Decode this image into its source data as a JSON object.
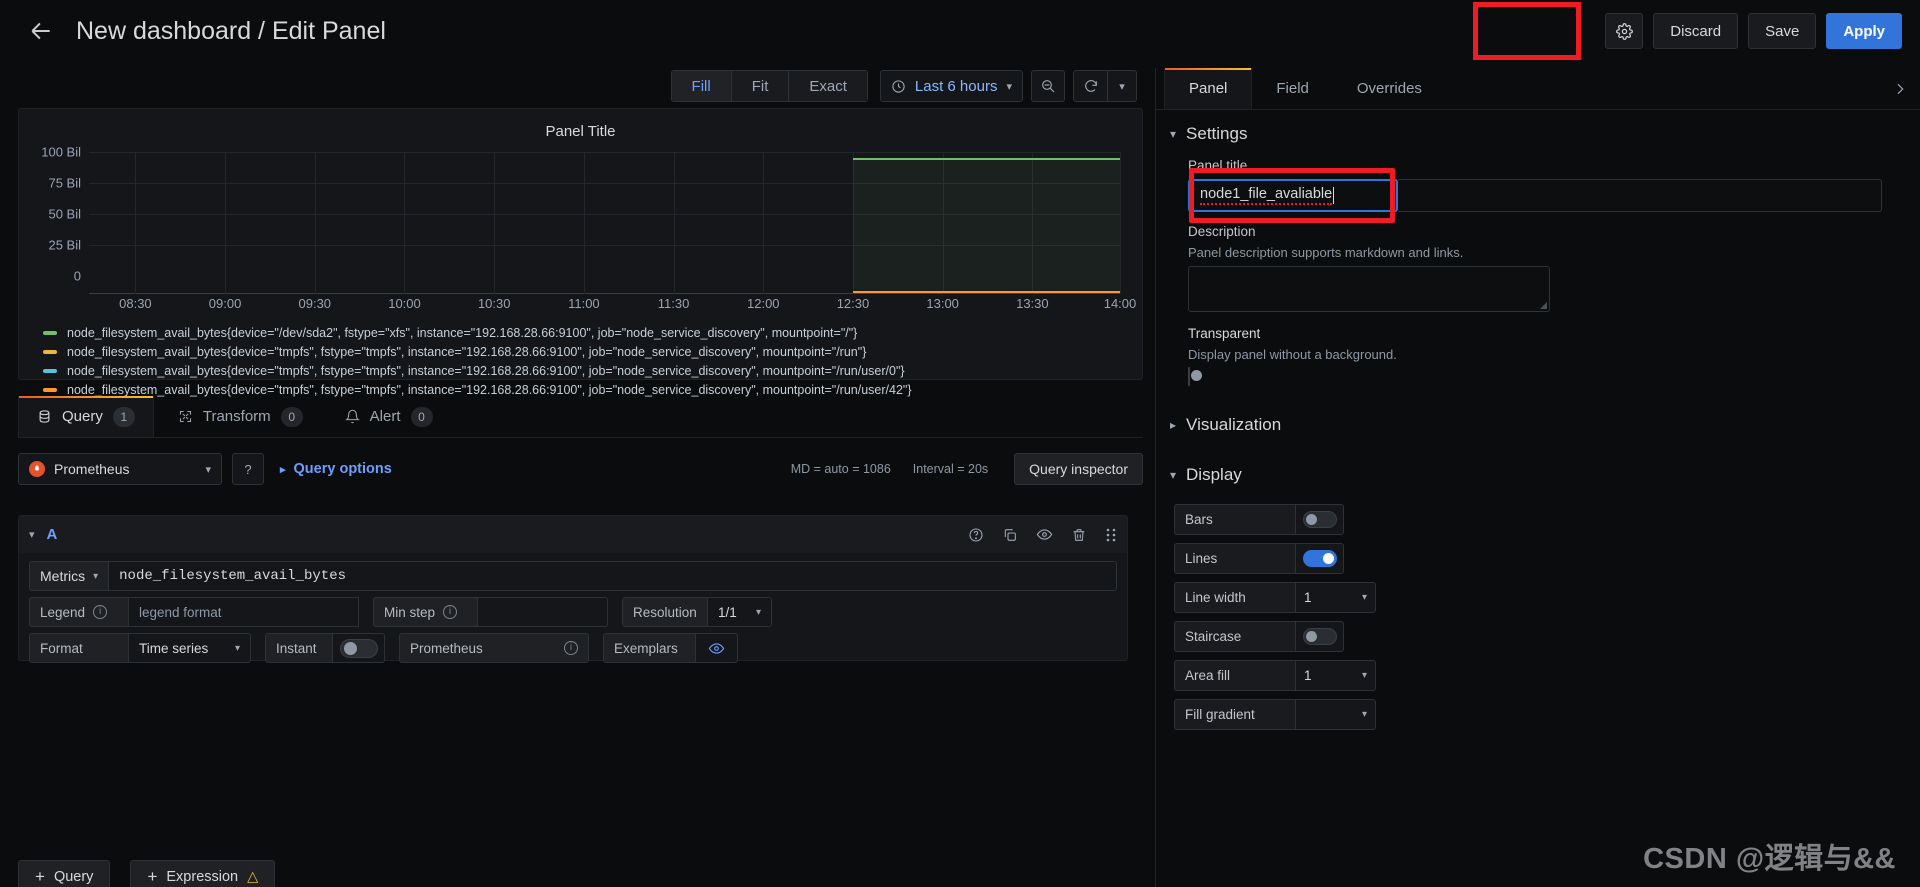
{
  "topbar": {
    "back_icon": "arrow-left-icon",
    "title": "New dashboard / Edit Panel",
    "settings_icon": "gear-icon",
    "discard_label": "Discard",
    "save_label": "Save",
    "apply_label": "Apply"
  },
  "graph_toolbar": {
    "fill_label": "Fill",
    "fit_label": "Fit",
    "exact_label": "Exact",
    "time_range": "Last 6 hours",
    "clock_icon": "clock-icon",
    "zoom_out_icon": "zoom-out-icon",
    "refresh_icon": "refresh-icon",
    "refresh_chevron_icon": "chevron-down-icon"
  },
  "panel": {
    "title": "Panel Title",
    "legend": [
      {
        "color": "#73bf69",
        "text": "node_filesystem_avail_bytes{device=\"/dev/sda2\", fstype=\"xfs\", instance=\"192.168.28.66:9100\", job=\"node_service_discovery\", mountpoint=\"/\"}"
      },
      {
        "color": "#eab839",
        "text": "node_filesystem_avail_bytes{device=\"tmpfs\", fstype=\"tmpfs\", instance=\"192.168.28.66:9100\", job=\"node_service_discovery\", mountpoint=\"/run\"}"
      },
      {
        "color": "#5bc0de",
        "text": "node_filesystem_avail_bytes{device=\"tmpfs\", fstype=\"tmpfs\", instance=\"192.168.28.66:9100\", job=\"node_service_discovery\", mountpoint=\"/run/user/0\"}"
      },
      {
        "color": "#ff9830",
        "text": "node_filesystem_avail_bytes{device=\"tmpfs\", fstype=\"tmpfs\", instance=\"192.168.28.66:9100\", job=\"node_service_discovery\", mountpoint=\"/run/user/42\"}"
      }
    ]
  },
  "chart_data": {
    "type": "line",
    "title": "Panel Title",
    "xlabel": "",
    "ylabel": "",
    "ylim": [
      0,
      100000000000
    ],
    "ytick_labels": [
      "100 Bil",
      "75 Bil",
      "50 Bil",
      "25 Bil",
      "0"
    ],
    "ytick_values": [
      100000000000,
      75000000000,
      50000000000,
      25000000000,
      0
    ],
    "xtick_labels": [
      "08:30",
      "09:00",
      "09:30",
      "10:00",
      "10:30",
      "11:00",
      "11:30",
      "12:00",
      "12:30",
      "13:00",
      "13:30",
      "14:00"
    ],
    "grid": true,
    "legend_position": "bottom",
    "series": [
      {
        "name": "node_filesystem_avail_bytes{device=\"/dev/sda2\", fstype=\"xfs\", instance=\"192.168.28.66:9100\", job=\"node_service_discovery\", mountpoint=\"/\"}",
        "color": "#73bf69",
        "x": [
          "12:30",
          "13:00",
          "13:30",
          "14:00"
        ],
        "values": [
          97000000000,
          97000000000,
          97000000000,
          97000000000
        ]
      },
      {
        "name": "node_filesystem_avail_bytes{device=\"tmpfs\", fstype=\"tmpfs\", instance=\"192.168.28.66:9100\", job=\"node_service_discovery\", mountpoint=\"/run\"}",
        "color": "#eab839",
        "x": [
          "12:30",
          "13:00",
          "13:30",
          "14:00"
        ],
        "values": [
          1000000000,
          1000000000,
          1000000000,
          1000000000
        ]
      },
      {
        "name": "node_filesystem_avail_bytes{device=\"tmpfs\", fstype=\"tmpfs\", instance=\"192.168.28.66:9100\", job=\"node_service_discovery\", mountpoint=\"/run/user/0\"}",
        "color": "#5bc0de",
        "x": [
          "12:30",
          "13:00",
          "13:30",
          "14:00"
        ],
        "values": [
          200000000,
          200000000,
          200000000,
          200000000
        ]
      },
      {
        "name": "node_filesystem_avail_bytes{device=\"tmpfs\", fstype=\"tmpfs\", instance=\"192.168.28.66:9100\", job=\"node_service_discovery\", mountpoint=\"/run/user/42\"}",
        "color": "#ff9830",
        "x": [
          "12:30",
          "13:00",
          "13:30",
          "14:00"
        ],
        "values": [
          200000000,
          200000000,
          200000000,
          200000000
        ]
      }
    ]
  },
  "query_tabs": {
    "query_label": "Query",
    "query_count": "1",
    "query_icon": "database-icon",
    "transform_label": "Transform",
    "transform_count": "0",
    "transform_icon": "transform-icon",
    "alert_label": "Alert",
    "alert_count": "0",
    "alert_icon": "bell-icon"
  },
  "query_options": {
    "datasource": "Prometheus",
    "datasource_icon": "prometheus-logo",
    "help_icon": "help-circle-icon",
    "options_label": "Query options",
    "max_data_points": "MD = auto = 1086",
    "interval": "Interval = 20s",
    "inspector_label": "Query inspector"
  },
  "query_row": {
    "letter": "A",
    "collapse_icon": "chevron-down-icon",
    "help_icon": "help-circle-icon",
    "duplicate_icon": "copy-icon",
    "hide_icon": "eye-icon",
    "delete_icon": "trash-icon",
    "drag_icon": "drag-handle-icon",
    "metrics_label": "Metrics",
    "metrics_chevron_icon": "chevron-down-icon",
    "expr": "node_filesystem_avail_bytes",
    "legend_label": "Legend",
    "legend_info_icon": "info-icon",
    "legend_placeholder": "legend format",
    "min_step_label": "Min step",
    "min_step_info_icon": "info-icon",
    "min_step_value": "",
    "resolution_label": "Resolution",
    "resolution_value": "1/1",
    "resolution_chevron_icon": "chevron-down-icon",
    "format_label": "Format",
    "format_value": "Time series",
    "format_chevron_icon": "chevron-down-icon",
    "instant_label": "Instant",
    "instant_toggle": "off",
    "prometheus_label": "Prometheus",
    "prometheus_info_icon": "info-icon",
    "exemplars_label": "Exemplars",
    "exemplars_icon": "eye-icon"
  },
  "add_buttons": {
    "query_label": "Query",
    "query_icon": "plus-icon",
    "expression_label": "Expression",
    "expression_icon": "plus-icon",
    "expression_warn_icon": "warning-icon"
  },
  "options_pane": {
    "tabs": [
      {
        "label": "Panel",
        "active": true
      },
      {
        "label": "Field",
        "active": false
      },
      {
        "label": "Overrides",
        "active": false
      }
    ],
    "expand_icon": "chevron-right-icon",
    "settings": {
      "heading": "Settings",
      "chevron_icon": "chevron-down-icon",
      "panel_title_label": "Panel title",
      "panel_title_value": "node1_file_avaliable",
      "description_label": "Description",
      "description_help": "Panel description supports markdown and links.",
      "description_value": "",
      "transparent_label": "Transparent",
      "transparent_help": "Display panel without a background.",
      "transparent_state": "off"
    },
    "visualization": {
      "heading": "Visualization",
      "chevron_icon": "chevron-right-icon"
    },
    "display": {
      "heading": "Display",
      "chevron_icon": "chevron-down-icon",
      "rows": [
        {
          "label": "Bars",
          "control": "switch",
          "value": "off"
        },
        {
          "label": "Lines",
          "control": "switch",
          "value": "on"
        },
        {
          "label": "Line width",
          "control": "select",
          "value": "1"
        },
        {
          "label": "Staircase",
          "control": "switch",
          "value": "off"
        },
        {
          "label": "Area fill",
          "control": "select",
          "value": "1"
        },
        {
          "label": "Fill gradient",
          "control": "select",
          "value": ""
        }
      ]
    }
  },
  "watermark": "CSDN @逻辑与&&",
  "colors": {
    "accent_blue": "#3274d9",
    "annotation_red": "#ee1c25",
    "tab_gradient_start": "#f05a28",
    "tab_gradient_end": "#fbc02d"
  }
}
